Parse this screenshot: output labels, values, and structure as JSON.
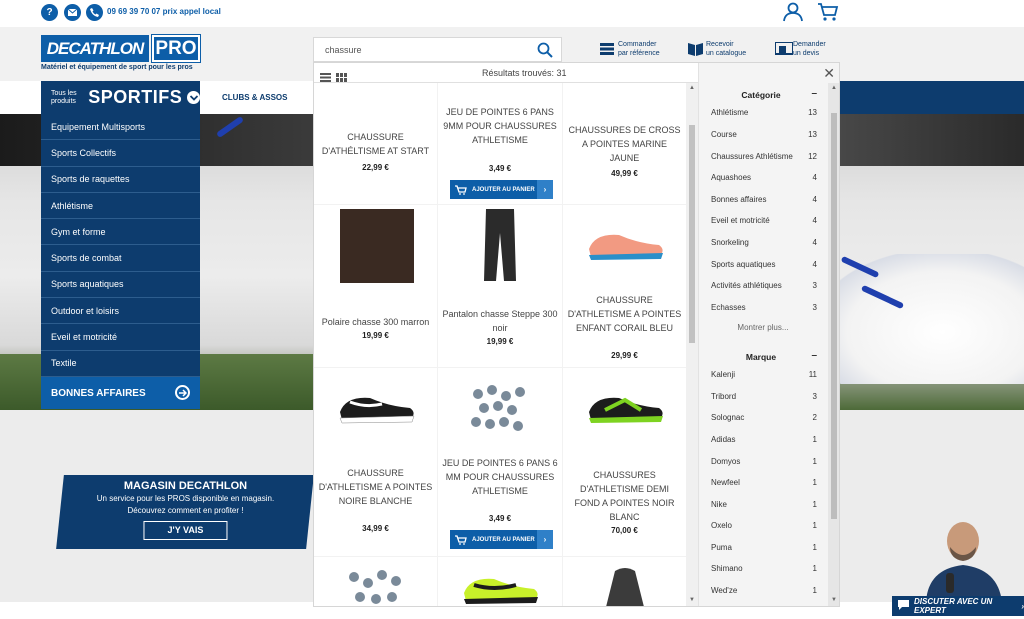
{
  "topbar": {
    "phone_text": "09 69 39 70 07 prix appel local",
    "icons": [
      "help-icon",
      "mail-icon",
      "phone-icon",
      "account-icon",
      "cart-icon"
    ]
  },
  "brand": {
    "logo_main": "DECATHLON",
    "logo_pro": "PRO",
    "tagline": "Matériel et équipement de sport pour les pros",
    "primary_color": "#0d5ea8",
    "dark_color": "#0d3c6e"
  },
  "header_links": [
    {
      "line1": "Commander",
      "line2": "par référence"
    },
    {
      "line1": "Recevoir",
      "line2": "un catalogue"
    },
    {
      "line1": "Demander",
      "line2": "un devis"
    }
  ],
  "search": {
    "value": "chassure",
    "placeholder": ""
  },
  "nav": {
    "tous_les_produits": "Tous les produits",
    "sportifs": "SPORTIFS",
    "clubs": "CLUBS & ASSOS"
  },
  "menu": {
    "items": [
      "Equipement Multisports",
      "Sports Collectifs",
      "Sports de raquettes",
      "Athlétisme",
      "Gym et forme",
      "Sports de combat",
      "Sports aquatiques",
      "Outdoor et loisirs",
      "Eveil et motricité",
      "Textile"
    ],
    "bonnes_affaires": "BONNES AFFAIRES"
  },
  "magasin": {
    "title": "MAGASIN DECATHLON",
    "line1": "Un service pour les PROS disponible en magasin.",
    "line2": "Découvrez comment en profiter !",
    "button": "J'Y VAIS"
  },
  "results": {
    "count_label": "Résultats trouvés: 31",
    "add_to_cart": "AJOUTER AU PANIER",
    "products": [
      {
        "name": "CHAUSSURE D'ATHÉLTISME AT START",
        "price": "22,99 €"
      },
      {
        "name": "JEU DE POINTES 6 PANS 9MM POUR CHAUSSURES ATHLETISME",
        "price": "3,49 €"
      },
      {
        "name": "CHAUSSURES DE CROSS A POINTES MARINE JAUNE",
        "price": "49,99 €"
      },
      {
        "name": "Polaire chasse 300 marron",
        "price": "19,99 €"
      },
      {
        "name": "Pantalon chasse Steppe 300 noir",
        "price": "19,99 €"
      },
      {
        "name": "CHAUSSURE D'ATHLETISME A POINTES ENFANT CORAIL BLEU",
        "price": "29,99 €"
      },
      {
        "name": "CHAUSSURE D'ATHLETISME A POINTES NOIRE BLANCHE",
        "price": "34,99 €"
      },
      {
        "name": "JEU DE POINTES 6 PANS 6 MM POUR CHAUSSURES ATHLETISME",
        "price": "3,49 €"
      },
      {
        "name": "CHAUSSURES D'ATHLETISME DEMI FOND A POINTES NOIR BLANC",
        "price": "70,00 €"
      }
    ]
  },
  "facets": {
    "categorie_title": "Catégorie",
    "categories": [
      {
        "label": "Athlétisme",
        "count": "13"
      },
      {
        "label": "Course",
        "count": "13"
      },
      {
        "label": "Chaussures Athlétisme",
        "count": "12"
      },
      {
        "label": "Aquashoes",
        "count": "4"
      },
      {
        "label": "Bonnes affaires",
        "count": "4"
      },
      {
        "label": "Eveil et motricité",
        "count": "4"
      },
      {
        "label": "Snorkeling",
        "count": "4"
      },
      {
        "label": "Sports aquatiques",
        "count": "4"
      },
      {
        "label": "Activités athlétiques",
        "count": "3"
      },
      {
        "label": "Echasses",
        "count": "3"
      }
    ],
    "more": "Montrer plus...",
    "marque_title": "Marque",
    "brands": [
      {
        "label": "Kalenji",
        "count": "11"
      },
      {
        "label": "Tribord",
        "count": "3"
      },
      {
        "label": "Solognac",
        "count": "2"
      },
      {
        "label": "Adidas",
        "count": "1"
      },
      {
        "label": "Domyos",
        "count": "1"
      },
      {
        "label": "Newfeel",
        "count": "1"
      },
      {
        "label": "Nike",
        "count": "1"
      },
      {
        "label": "Oxelo",
        "count": "1"
      },
      {
        "label": "Puma",
        "count": "1"
      },
      {
        "label": "Shimano",
        "count": "1"
      },
      {
        "label": "Wed'ze",
        "count": "1"
      }
    ]
  },
  "expert": {
    "button": "DISCUTER AVEC UN EXPERT"
  }
}
